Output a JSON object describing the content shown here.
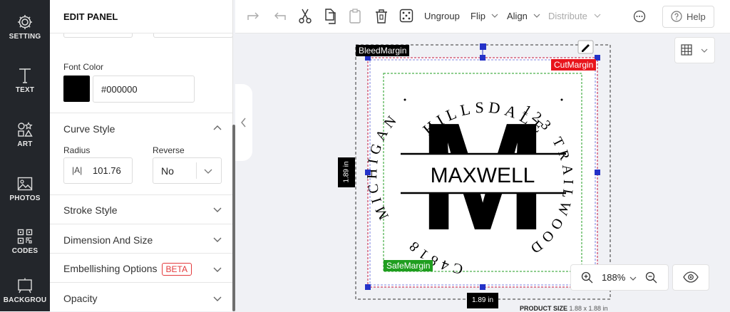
{
  "rail": {
    "items": [
      {
        "label": "SETTING",
        "icon": "gear-icon"
      },
      {
        "label": "TEXT",
        "icon": "text-icon"
      },
      {
        "label": "ART",
        "icon": "shapes-icon"
      },
      {
        "label": "PHOTOS",
        "icon": "image-icon"
      },
      {
        "label": "CODES",
        "icon": "qr-code-icon"
      },
      {
        "label": "BACKGROU",
        "icon": "background-icon"
      }
    ]
  },
  "panel": {
    "title": "EDIT PANEL",
    "font_color": {
      "label": "Font Color",
      "value": "#000000",
      "swatch": "#000000"
    },
    "curve_style": {
      "title": "Curve Style",
      "radius_label": "Radius",
      "radius_icon_text": "|A|",
      "radius_value": "101.76",
      "reverse_label": "Reverse",
      "reverse_value": "No"
    },
    "sections": [
      {
        "title": "Stroke Style"
      },
      {
        "title": "Dimension And Size"
      },
      {
        "title": "Embellishing Options",
        "badge": "BETA"
      },
      {
        "title": "Opacity"
      }
    ]
  },
  "toolbar": {
    "ungroup": "Ungroup",
    "flip": "Flip",
    "align": "Align",
    "distribute": "Distribute",
    "help": "Help"
  },
  "canvas": {
    "bleed_label": "BleedMargin",
    "cut_label": "CutMargin",
    "safe_label": "SafeMargin",
    "width_label": "1.89 in",
    "height_label": "1.89 in",
    "zoom": "188%",
    "product_size_label": "PRODUCT SIZE",
    "product_size_value": "1.88 x 1.88 in",
    "design": {
      "monogram": "M",
      "name": "MAXWELL",
      "arc_top": "HILLSDALE",
      "arc_right": "123 TRAILWOOD",
      "arc_bottom": "C4818",
      "arc_left": "MICHIGAN"
    }
  },
  "colors": {
    "rail_bg": "#23262b",
    "accent_red": "#e4393c",
    "bleed_tag": "#000000",
    "cut_tag": "#e8141c",
    "safe_tag": "#1f9e1f",
    "handle": "#2432c8"
  }
}
